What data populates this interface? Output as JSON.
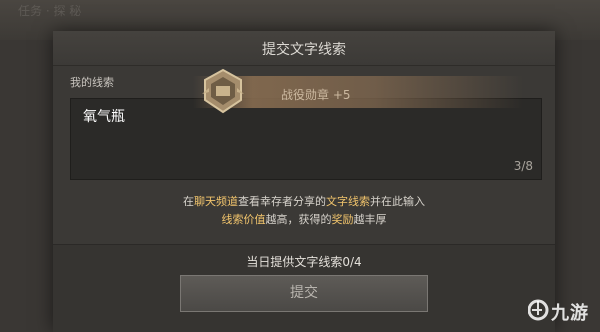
{
  "background": {
    "faded_text": "任务 · 探 秘"
  },
  "dialog": {
    "title": "提交文字线索",
    "section_label": "我的线索",
    "input": {
      "value": "氧气瓶",
      "count": "3/8"
    },
    "reward": {
      "text": "战役勋章 +5",
      "icon": "medal-icon"
    },
    "hint": {
      "line1": {
        "a": "在",
        "b": "聊天频道",
        "c": "查看幸存者分享的",
        "d": "文字线索",
        "e": "并在此输入"
      },
      "line2": {
        "a": "线索价值",
        "b": "越高，获得的",
        "c": "奖励",
        "d": "越丰厚"
      }
    },
    "daily": {
      "label": "当日提供文字线索",
      "value": "0/4"
    },
    "submit_label": "提交"
  },
  "watermark": {
    "text": "九游"
  },
  "colors": {
    "highlight": "#f1c46c",
    "panel": "#3b3936",
    "input": "#2b2a28"
  }
}
